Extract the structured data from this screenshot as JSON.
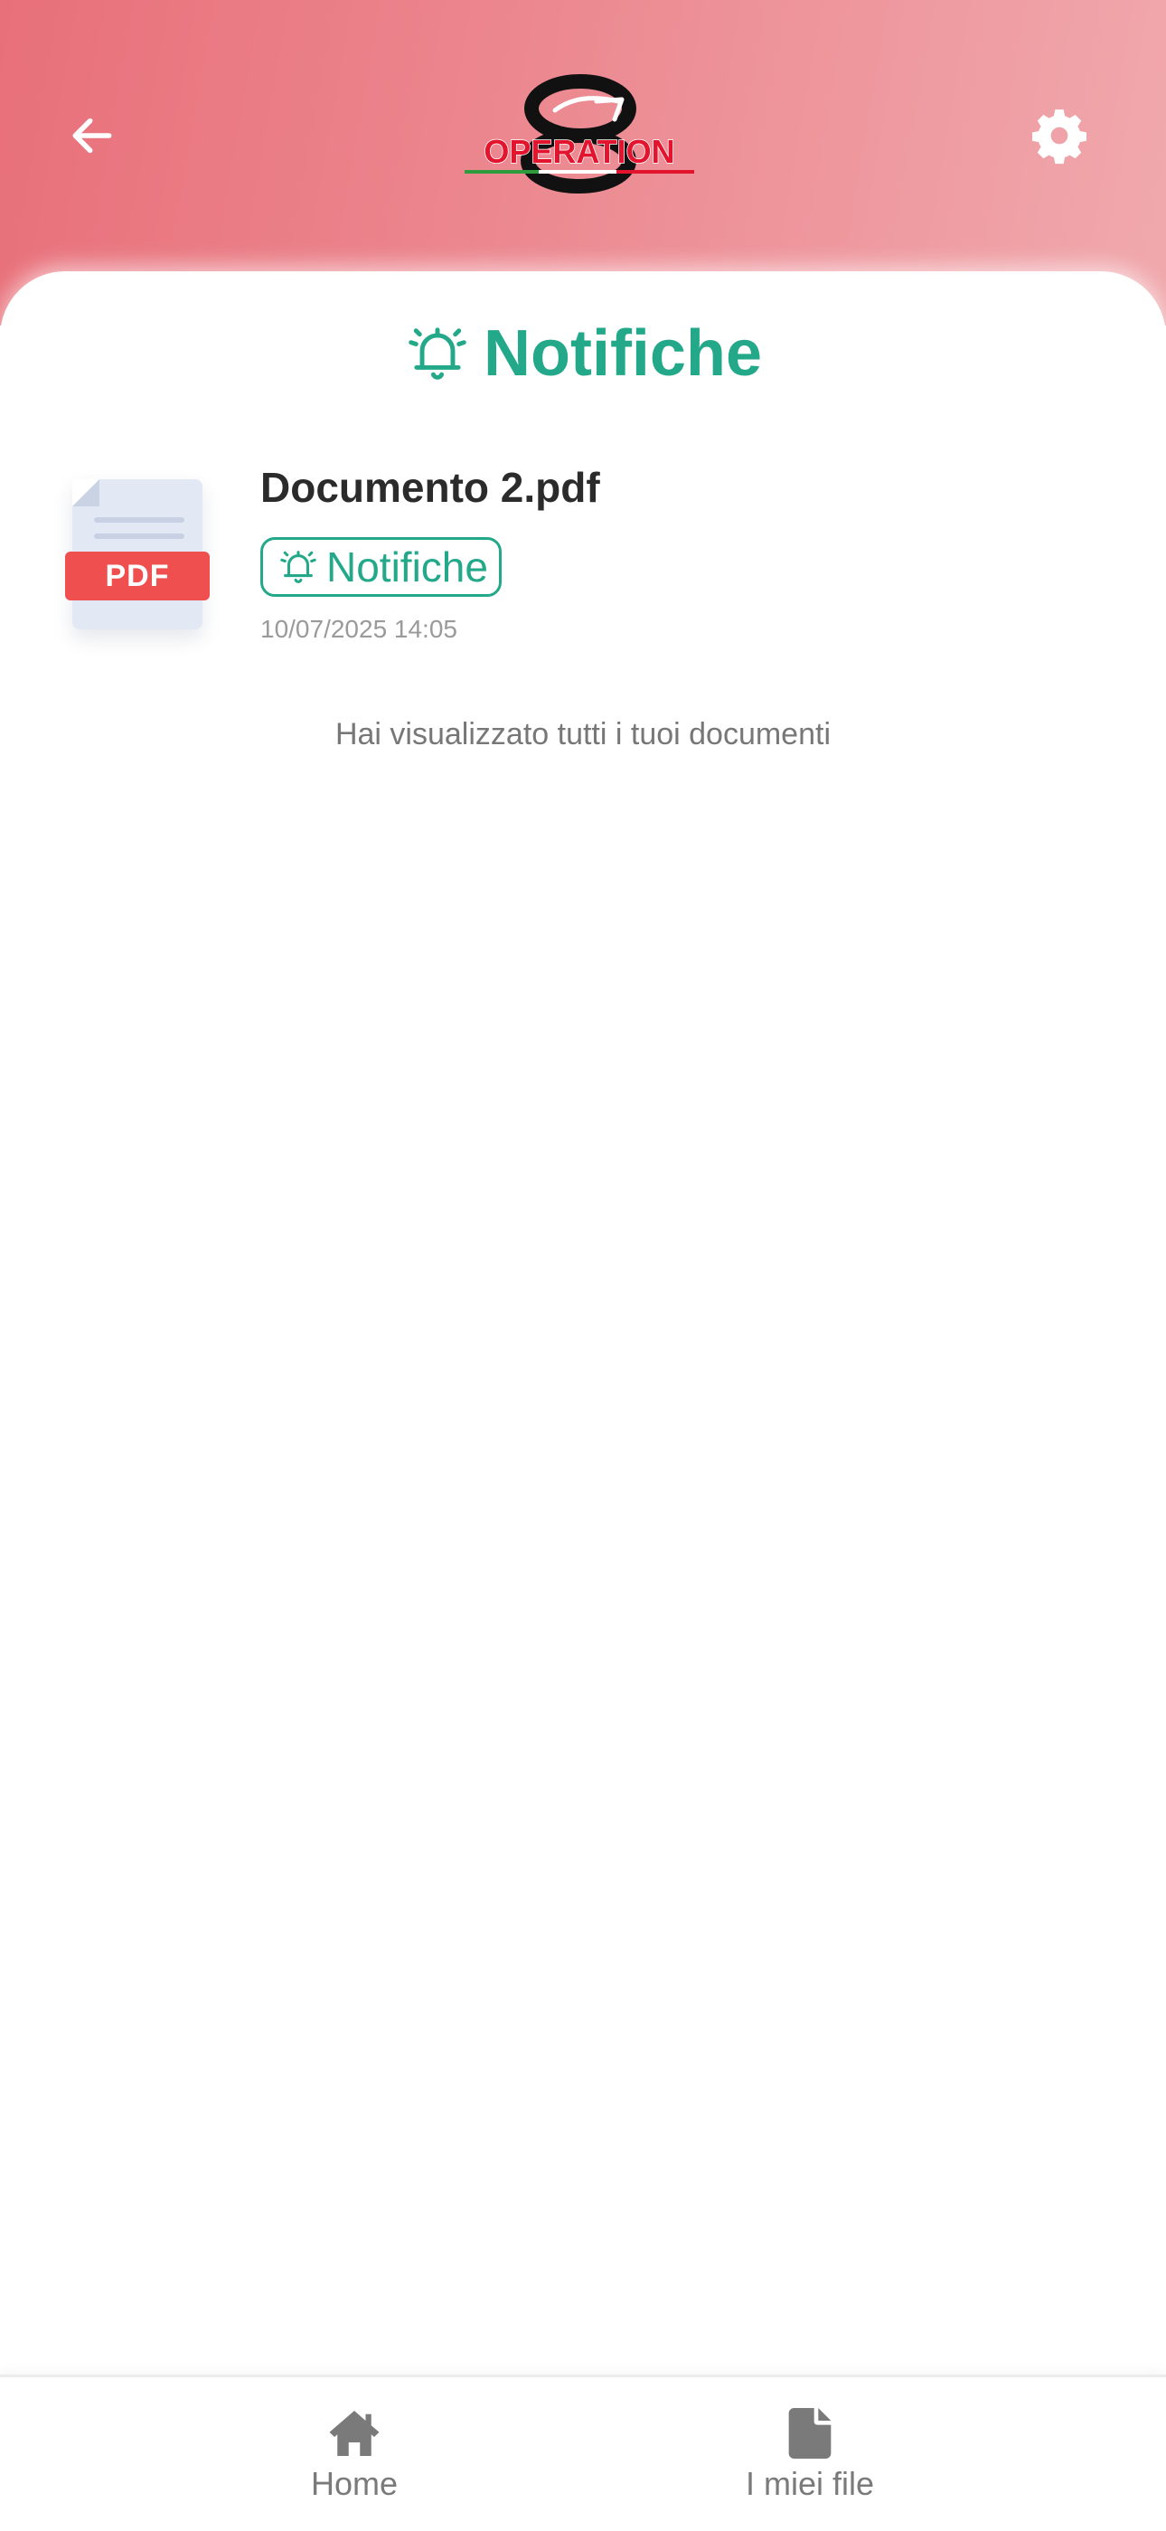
{
  "header": {
    "logo_text": "OPERATION",
    "back_icon": "arrow-left-icon",
    "settings_icon": "gear-icon",
    "colors": {
      "gradient_start": "#e8707a",
      "gradient_end": "#f0a9ad"
    }
  },
  "page": {
    "title": "Notifiche",
    "title_icon": "bell-ring-icon",
    "accent_color": "#23a98a"
  },
  "documents": [
    {
      "file_type_badge": "PDF",
      "name": "Documento 2.pdf",
      "tag_label": "Notifiche",
      "tag_icon": "bell-ring-icon",
      "datetime": "10/07/2025 14:05"
    }
  ],
  "end_message": "Hai visualizzato tutti i tuoi documenti",
  "bottom_nav": {
    "items": [
      {
        "label": "Home",
        "icon": "home-icon"
      },
      {
        "label": "I miei file",
        "icon": "file-icon"
      }
    ]
  }
}
